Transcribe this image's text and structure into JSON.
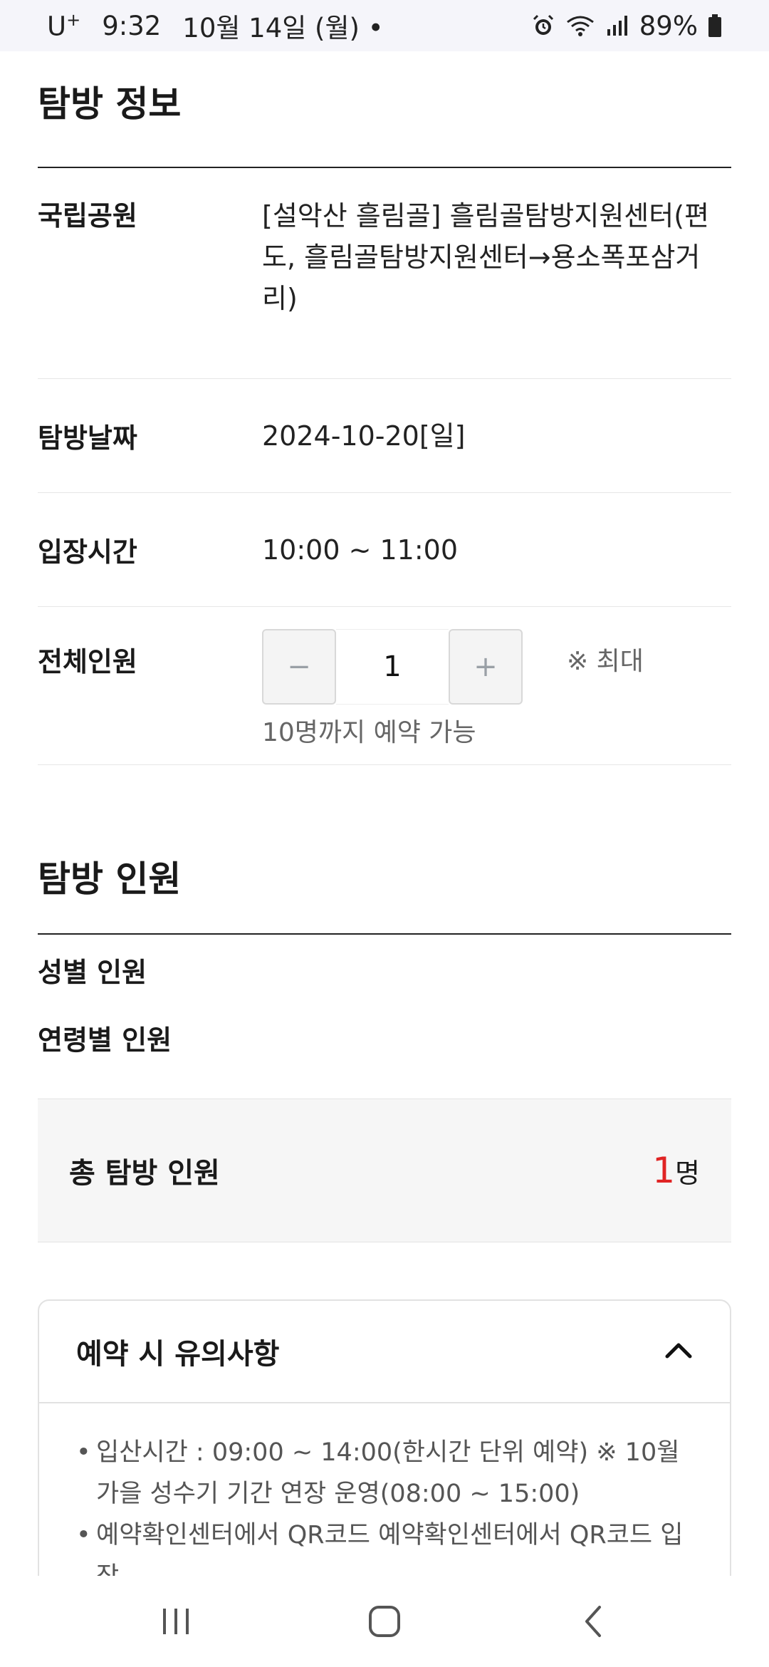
{
  "status_bar": {
    "carrier": "U",
    "carrier_sup": "+",
    "time": "9:32",
    "date": "10월 14일 (월)",
    "dot": "•",
    "battery": "89%",
    "icons": [
      "alarm-icon",
      "wifi-icon",
      "signal-icon",
      "battery-icon"
    ]
  },
  "info_section": {
    "title": "탐방 정보",
    "park_label": "국립공원",
    "park_value": "[설악산 흘림골] 흘림골탐방지원센터(편도, 흘림골탐방지원센터→용소폭포삼거리)",
    "date_label": "탐방날짜",
    "date_value": "2024-10-20[일]",
    "time_label": "입장시간",
    "time_value": "10:00 ~ 11:00",
    "total_label": "전체인원",
    "stepper": {
      "minus": "−",
      "value": "1",
      "plus": "+"
    },
    "max_note_1": "※ 최대",
    "max_note_2": "10명까지 예약 가능"
  },
  "people_section": {
    "title": "탐방 인원",
    "gender_label": "성별 인원",
    "age_label": "연령별 인원",
    "total_label": "총 탐방 인원",
    "total_count": "1",
    "total_unit": "명"
  },
  "notice": {
    "title": "예약 시 유의사항",
    "items": [
      "입산시간 : 09:00 ~ 14:00(한시간 단위 예약) ※ 10월 가을 성수기 기간 연장 운영(08:00 ~ 15:00)",
      "예약확인센터에서 QR코드 예약확인센터에서 QR코드 입장"
    ]
  },
  "colors": {
    "accent_red": "#e02424",
    "total_bg": "#f6f6f6",
    "status_bg": "#f5f5fa"
  }
}
